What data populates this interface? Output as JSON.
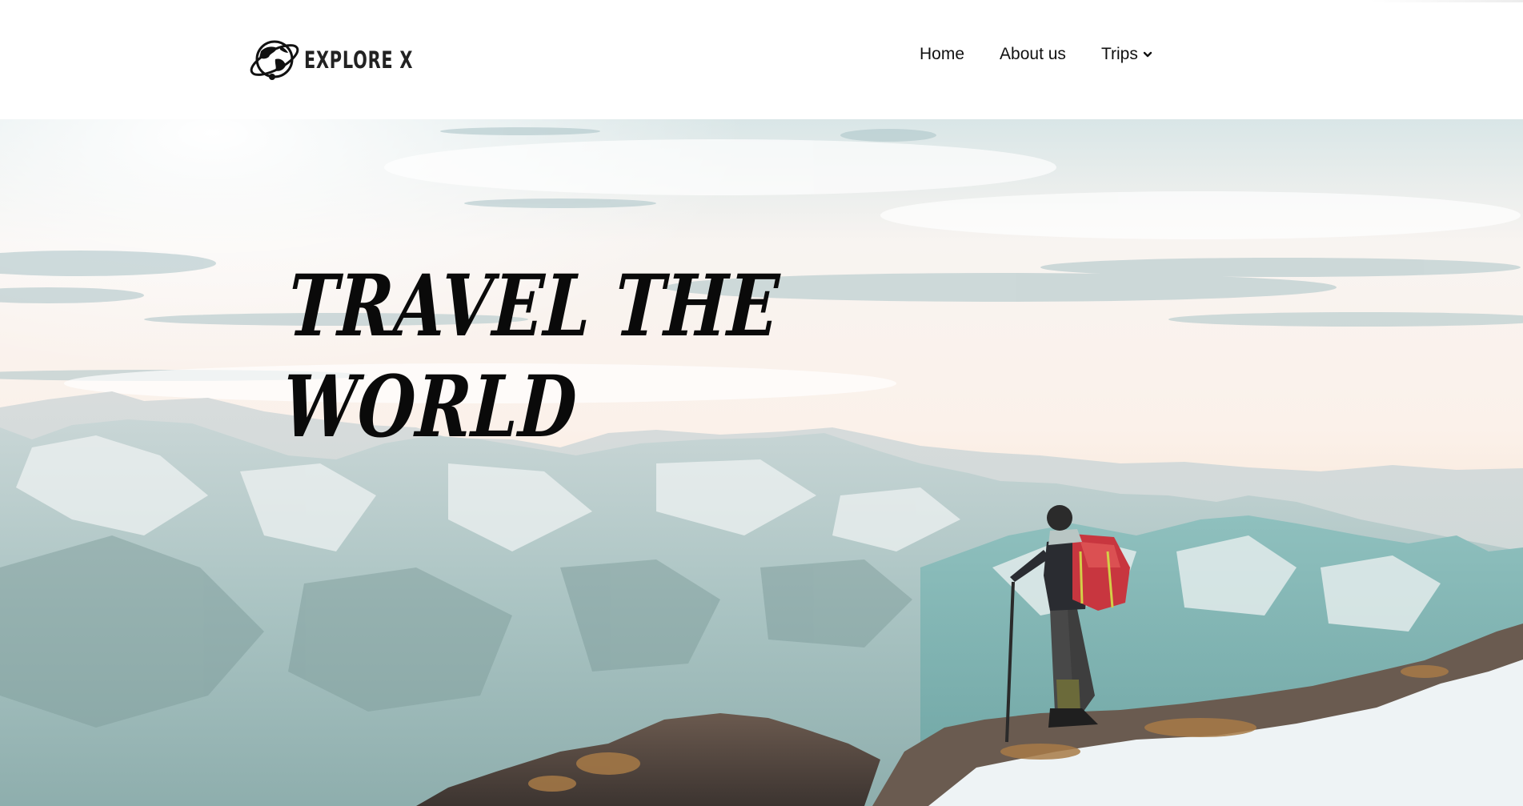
{
  "brand": {
    "name": "EXPLORE X",
    "logo_icon": "globe-orbit-icon"
  },
  "nav": {
    "items": [
      {
        "label": "Home"
      },
      {
        "label": "About us"
      },
      {
        "label": "Trips",
        "icon": "chevron-down-icon"
      }
    ]
  },
  "hero": {
    "title_line1": "TRAVEL THE",
    "title_line2": "WORLD",
    "image": "hiker-on-mountain-summit"
  },
  "colors": {
    "text": "#111111",
    "sky": "#fbf4ee",
    "mountain": "#9fbdbb",
    "backpack": "#c8363f"
  }
}
